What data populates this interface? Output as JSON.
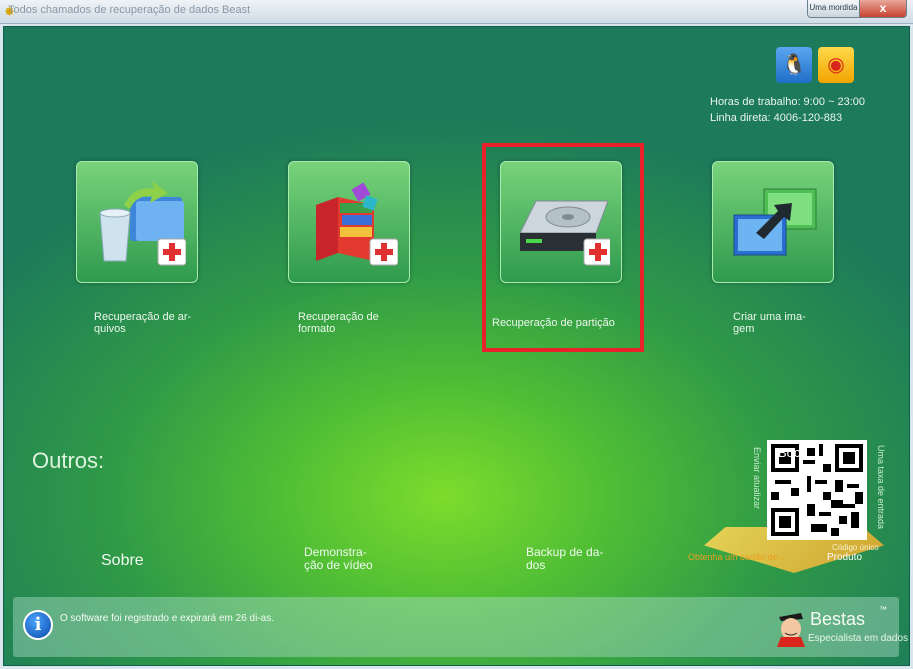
{
  "window": {
    "title": "Todos chamados de recuperação de dados Beast",
    "minimize_label": "Uma mordida",
    "close_label": "x"
  },
  "contact": {
    "hours": "Horas de trabalho: 9:00 ~ 23:00",
    "hotline": "Linha direta: 4006-120-883"
  },
  "tiles": [
    {
      "line1": "Recuperação de ar-",
      "line2": "quivos"
    },
    {
      "line1": "Recuperação de",
      "line2": "formato"
    },
    {
      "line1": "Recuperação de partição",
      "line2": ""
    },
    {
      "line1": "Criar uma ima-",
      "line2": "gem"
    }
  ],
  "others": {
    "heading": "Outros:",
    "about": "Sobre",
    "video_line1": "Demonstra-",
    "video_line2": "ção de vídeo",
    "backup_line1": "Backup de da-",
    "backup_line2": "dos"
  },
  "qr": {
    "left_side": "Enviar atualizar",
    "right_side": "Uma taxa de entrada",
    "top_caption": "Boca",
    "caption_bottom": "Código único",
    "gold_caption": "Obtenha um cartão de...",
    "gold_caption2": "Produto"
  },
  "footer": {
    "notice": "O software foi registrado e expirará em 26 di-as.",
    "brand": "Bestas",
    "tm": "™",
    "tagline": "Especialista em dados"
  },
  "colors": {
    "highlight": "#e8212b",
    "background_center": "#7ddc2c",
    "background_edge": "#1d7a5a"
  }
}
